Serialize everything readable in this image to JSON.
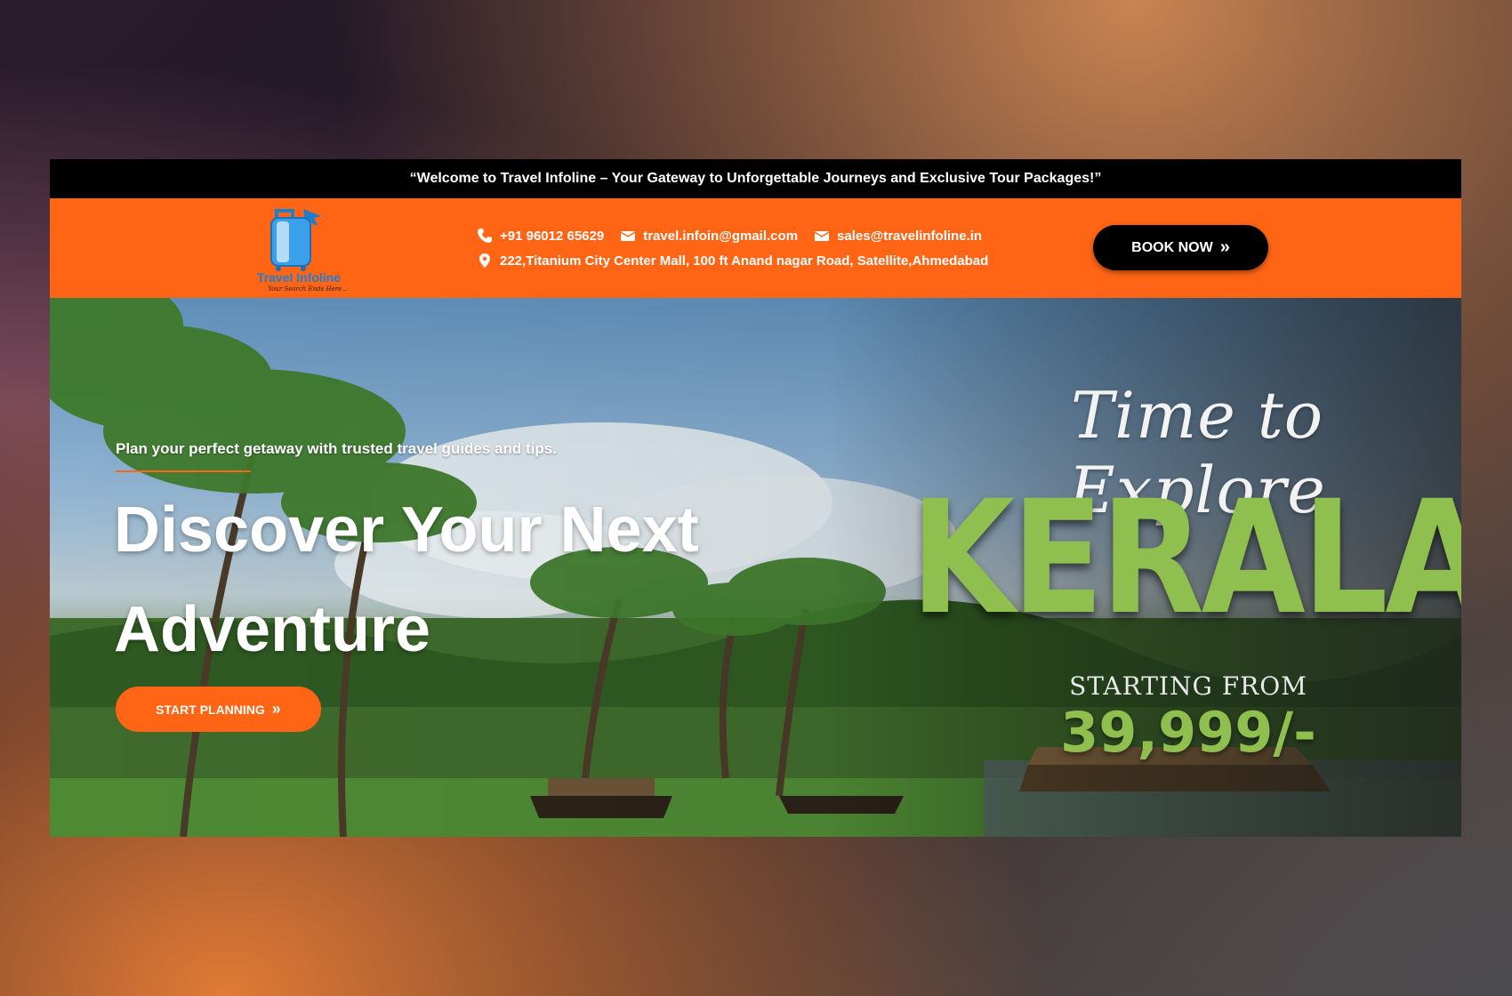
{
  "announcement": "“Welcome to Travel Infoline – Your Gateway to Unforgettable Journeys and Exclusive Tour Packages!”",
  "header": {
    "logo_title": "Travel Infoline",
    "logo_tagline": "Your Search Ends Here...",
    "phone": "+91 96012 65629",
    "email_primary": "travel.infoin@gmail.com",
    "email_sales": "sales@travelinfoline.in",
    "address": "222,Titanium City Center Mall, 100 ft Anand nagar Road, Satellite,Ahmedabad",
    "book_label": "BOOK NOW",
    "book_icon": "»"
  },
  "hero": {
    "tagline": "Plan your perfect getaway with trusted travel guides and tips.",
    "headline": "Discover Your Next Adventure",
    "cta_label": "START PLANNING",
    "cta_icon": "»"
  },
  "promo": {
    "script": "Time to Explore",
    "destination": "KERALA",
    "starting_label": "STARTING FROM",
    "price": "39,999/-"
  },
  "colors": {
    "accent": "#ff6514",
    "topbar": "#000000",
    "promo_green": "#8fbf4f"
  },
  "icons": [
    "phone-icon",
    "envelope-icon",
    "map-pin-icon",
    "suitcase-logo-icon",
    "double-chevron-icon"
  ]
}
